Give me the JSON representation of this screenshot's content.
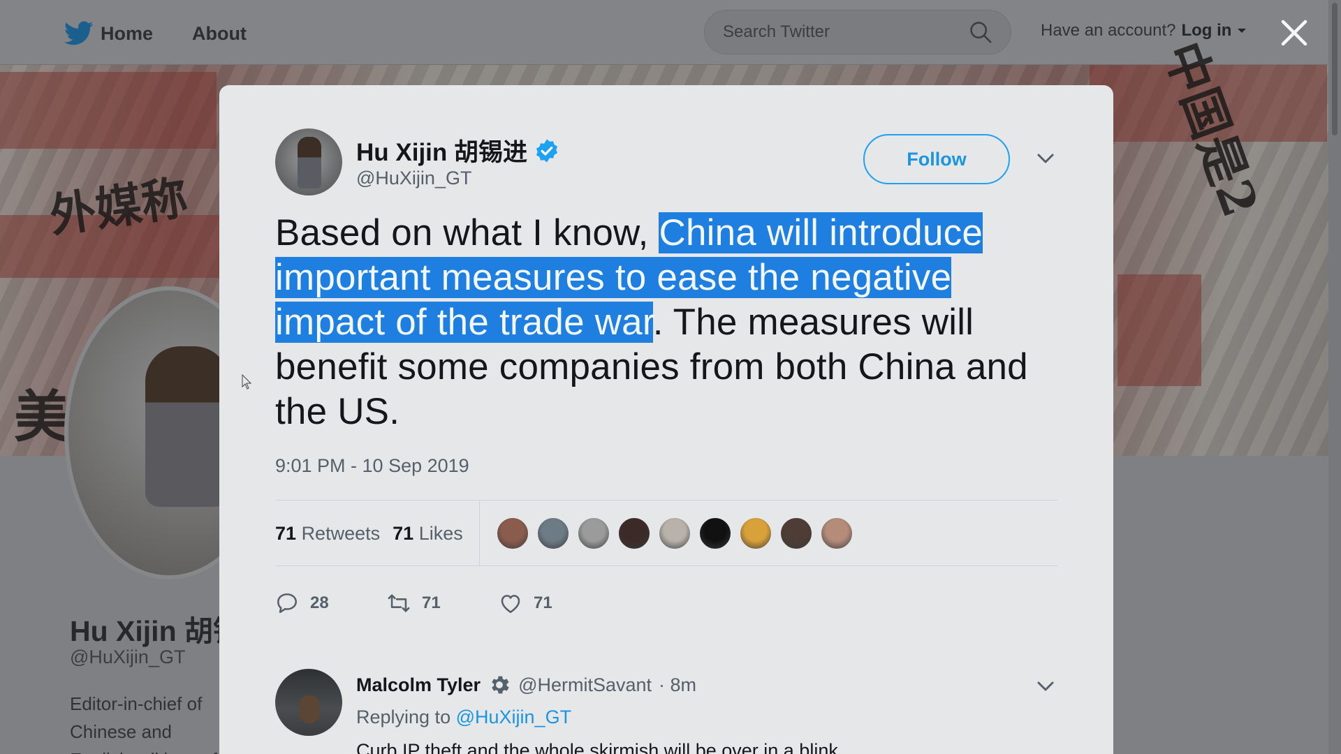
{
  "nav": {
    "home_label": "Home",
    "about_label": "About",
    "search_placeholder": "Search Twitter",
    "have_account": "Have an account?",
    "login_label": "Log in"
  },
  "profile_bg": {
    "name": "Hu Xijin 胡锡进",
    "handle": "@HuXijin_GT",
    "bio": "Editor-in-chief of Chinese and English editions of the Global Times."
  },
  "tweet": {
    "author_name": "Hu Xijin 胡锡进",
    "author_handle": "@HuXijin_GT",
    "verified": true,
    "follow_label": "Follow",
    "text_before": "Based on what I know, ",
    "text_highlighted": "China will introduce important measures to ease the negative impact of the trade war",
    "text_after": ". The measures will benefit some companies from both China and the US.",
    "timestamp": "9:01 PM - 10 Sep 2019",
    "retweets_count": "71",
    "retweets_label": "Retweets",
    "likes_count": "71",
    "likes_label": "Likes",
    "liker_colors": [
      "#8a5c4e",
      "#6d7b86",
      "#9a9b9a",
      "#3b2a28",
      "#b9b2ab",
      "#111111",
      "#d9a13a",
      "#4e3c36",
      "#b58b7a"
    ],
    "actions": {
      "replies": "28",
      "retweets": "71",
      "likes": "71"
    },
    "accent_color": "#1da1f2"
  },
  "reply": {
    "name": "Malcolm Tyler",
    "handle": "@HermitSavant",
    "time": "· 8m",
    "replying_to_label": "Replying to",
    "replying_to_handle": "@HuXijin_GT",
    "text": "Curb IP theft and the whole skirmish will be over in a blink."
  }
}
